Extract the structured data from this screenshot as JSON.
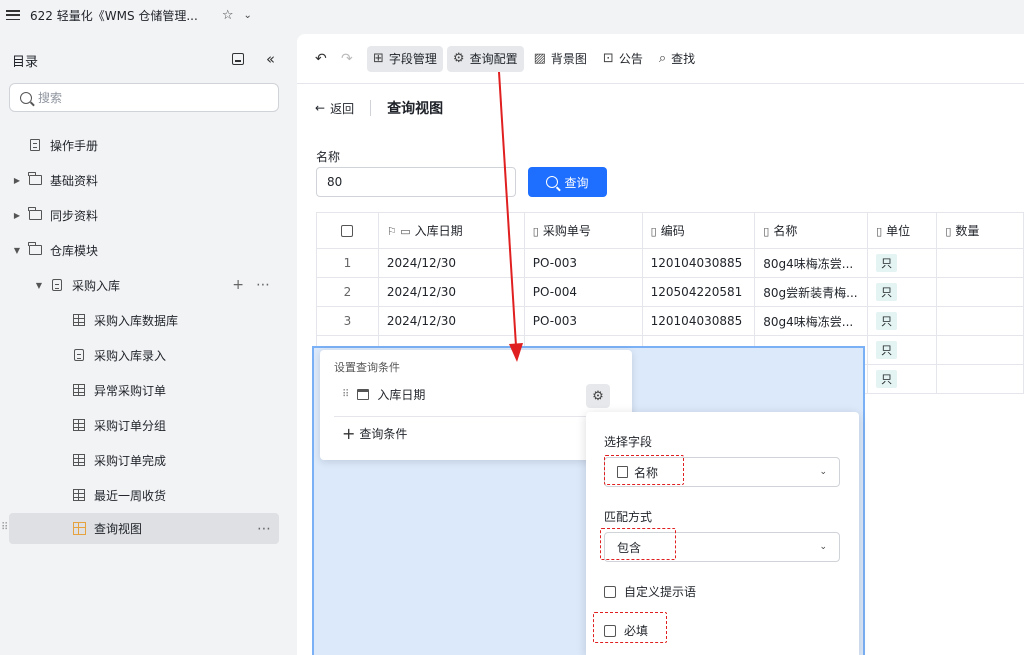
{
  "topbar": {
    "title": "622 轻量化《WMS 仓储管理..."
  },
  "sidebar": {
    "heading": "目录",
    "search_placeholder": "搜索",
    "items": [
      {
        "label": "操作手册"
      },
      {
        "label": "基础资料"
      },
      {
        "label": "同步资料"
      },
      {
        "label": "仓库模块"
      },
      {
        "label": "采购入库"
      },
      {
        "label": "采购入库数据库"
      },
      {
        "label": "采购入库录入"
      },
      {
        "label": "异常采购订单"
      },
      {
        "label": "采购订单分组"
      },
      {
        "label": "采购订单完成"
      },
      {
        "label": "最近一周收货"
      },
      {
        "label": "查询视图"
      }
    ]
  },
  "toolbar": {
    "field_mgmt": "字段管理",
    "query_config": "查询配置",
    "background": "背景图",
    "notice": "公告",
    "find": "查找"
  },
  "view": {
    "back": "返回",
    "title": "查询视图",
    "field_label": "名称",
    "field_value": "80",
    "query_button": "查询"
  },
  "table": {
    "columns": [
      "入库日期",
      "采购单号",
      "编码",
      "名称",
      "单位",
      "数量"
    ],
    "rows": [
      {
        "idx": "1",
        "date": "2024/12/30",
        "po": "PO-003",
        "code": "120104030885",
        "name": "80g4味梅冻尝...",
        "unit": "只"
      },
      {
        "idx": "2",
        "date": "2024/12/30",
        "po": "PO-004",
        "code": "120504220581",
        "name": "80g尝新装青梅...",
        "unit": "只"
      },
      {
        "idx": "3",
        "date": "2024/12/30",
        "po": "PO-003",
        "code": "120104030885",
        "name": "80g4味梅冻尝...",
        "unit": "只"
      },
      {
        "idx": "",
        "date": "",
        "po": "",
        "code": "",
        "name": "",
        "unit": "只"
      },
      {
        "idx": "",
        "date": "",
        "po": "",
        "code": "",
        "name": "",
        "unit": "只"
      }
    ]
  },
  "conditions": {
    "title": "设置查询条件",
    "item": "入库日期",
    "add": "查询条件"
  },
  "config": {
    "select_field_label": "选择字段",
    "select_field_value": "名称",
    "match_label": "匹配方式",
    "match_value": "包含",
    "custom_hint": "自定义提示语",
    "required": "必填"
  },
  "colors": {
    "accent": "#1e6fff",
    "annotation": "#e02020",
    "highlight_bg": "#dbe9fb"
  }
}
